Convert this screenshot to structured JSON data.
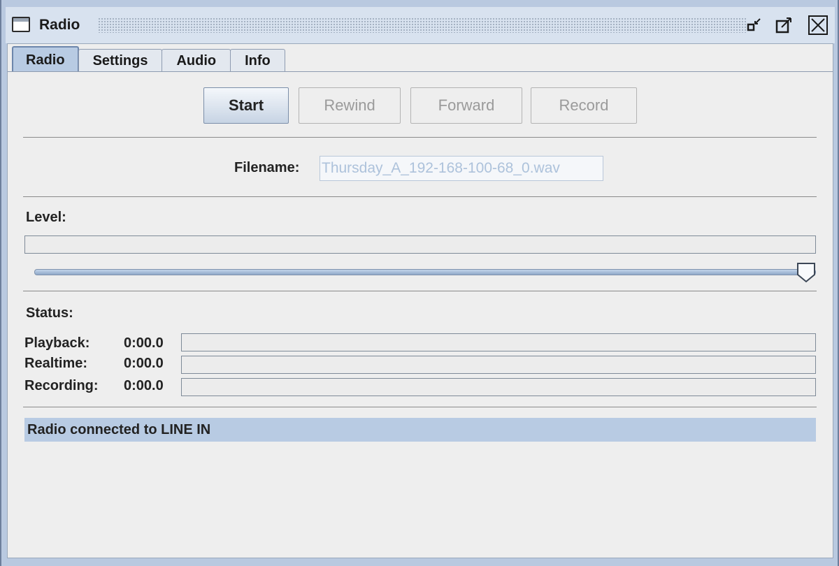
{
  "window": {
    "title": "Radio",
    "controls": {
      "minimize": "minimize-icon",
      "maximize": "maximize-icon",
      "close": "close-icon"
    }
  },
  "tabs": [
    {
      "label": "Radio",
      "active": true
    },
    {
      "label": "Settings",
      "active": false
    },
    {
      "label": "Audio",
      "active": false
    },
    {
      "label": "Info",
      "active": false
    }
  ],
  "buttons": {
    "start": "Start",
    "rewind": "Rewind",
    "forward": "Forward",
    "record": "Record"
  },
  "filename": {
    "label": "Filename:",
    "value": "Thursday_A_192-168-100-68_0.wav"
  },
  "level": {
    "label": "Level:",
    "meter_fraction": 0,
    "slider_fraction": 1.0
  },
  "status": {
    "label": "Status:",
    "rows": [
      {
        "label": "Playback:",
        "time": "0:00.0",
        "progress": 0
      },
      {
        "label": "Realtime:",
        "time": "0:00.0",
        "progress": 0
      },
      {
        "label": "Recording:",
        "time": "0:00.0",
        "progress": 0
      }
    ],
    "message": "Radio connected to LINE IN"
  },
  "colors": {
    "accent": "#b8cbe3",
    "disabled_text": "#9a9a9a",
    "input_text": "#adc2db"
  }
}
